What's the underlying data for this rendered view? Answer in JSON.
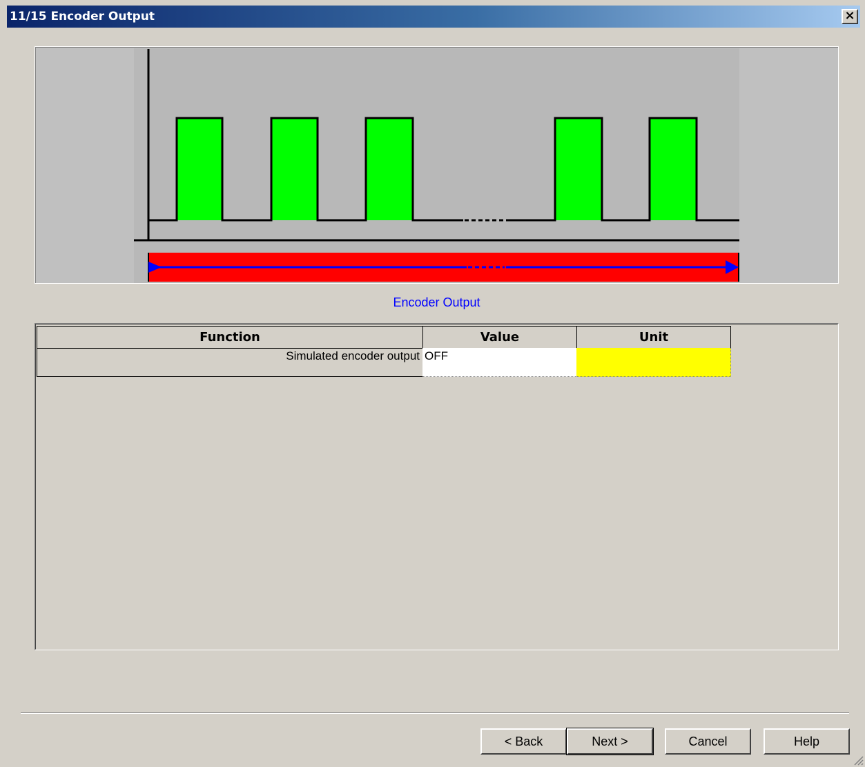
{
  "window": {
    "title": "11/15 Encoder Output",
    "close_glyph": "×"
  },
  "diagram": {
    "caption": "Encoder Output",
    "colors": {
      "background": "#c0c0c0",
      "pulse_fill": "#00ff00",
      "bar_fill": "#ff0000",
      "arrow": "#0000ff"
    }
  },
  "table": {
    "columns": [
      "Function",
      "Value",
      "Unit"
    ],
    "rows": [
      {
        "function": "Simulated encoder output",
        "value": "OFF",
        "unit": ""
      }
    ],
    "colors": {
      "value_bg": "#ffffff",
      "unit_bg": "#ffff00"
    }
  },
  "buttons": {
    "back": "< Back",
    "next": "Next >",
    "cancel": "Cancel",
    "help": "Help"
  }
}
